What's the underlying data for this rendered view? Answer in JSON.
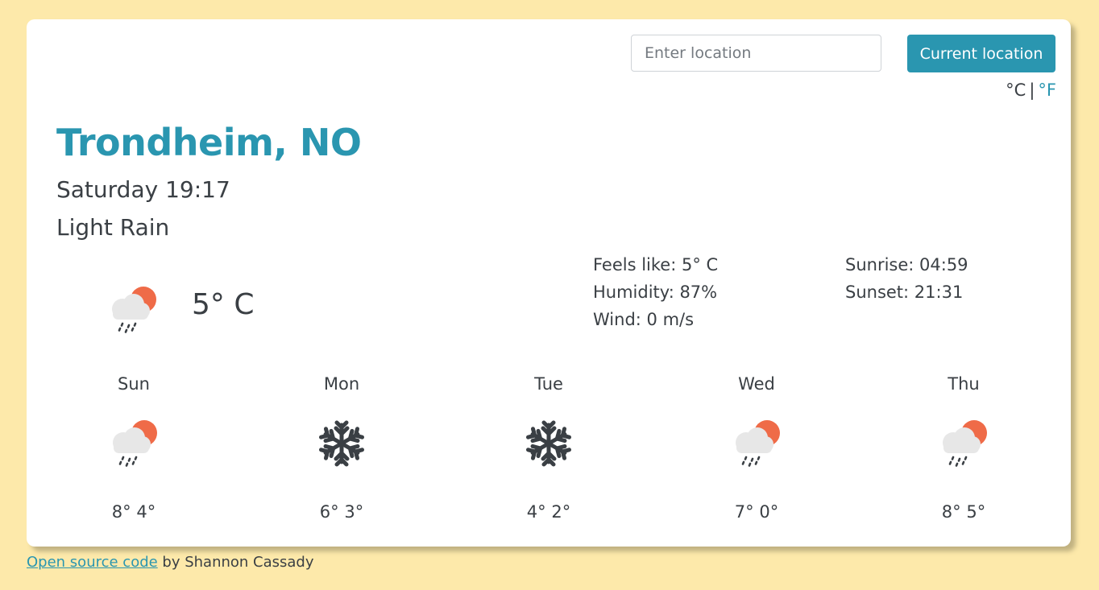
{
  "search": {
    "placeholder": "Enter location",
    "value": "",
    "current_location_label": "Current location"
  },
  "units": {
    "celsius": "°C",
    "separator": "|",
    "fahrenheit": "°F"
  },
  "current": {
    "city": "Trondheim, NO",
    "datetime": "Saturday 19:17",
    "condition": "Light Rain",
    "icon": "rain-sun-icon",
    "temperature": "5° C",
    "feels_like": "Feels like: 5° C",
    "humidity": "Humidity: 87%",
    "wind": "Wind: 0 m/s",
    "sunrise": "Sunrise: 04:59",
    "sunset": "Sunset: 21:31"
  },
  "forecast": [
    {
      "day": "Sun",
      "icon": "rain-sun-icon",
      "temps": "8° 4°"
    },
    {
      "day": "Mon",
      "icon": "snowflake-icon",
      "temps": "6° 3°"
    },
    {
      "day": "Tue",
      "icon": "snowflake-icon",
      "temps": "4° 2°"
    },
    {
      "day": "Wed",
      "icon": "rain-sun-icon",
      "temps": "7° 0°"
    },
    {
      "day": "Thu",
      "icon": "rain-sun-icon",
      "temps": "8° 5°"
    }
  ],
  "footer": {
    "link_text": "Open source code",
    "suffix": " by Shannon Cassady"
  },
  "colors": {
    "page_background": "#fde9aa",
    "accent": "#2a96b0",
    "sun": "#ef6b48",
    "cloud": "#e7e7e7",
    "text": "#3a3f44"
  }
}
